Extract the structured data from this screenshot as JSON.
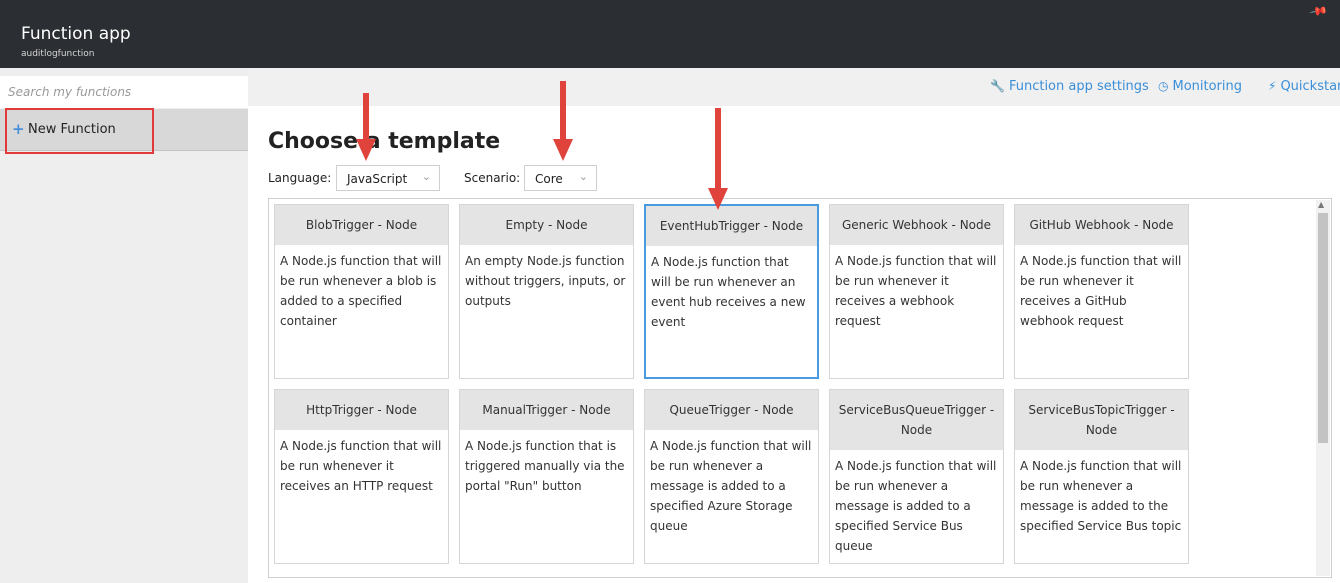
{
  "header": {
    "title": "Function app",
    "subtitle": "auditlogfunction"
  },
  "sidebar": {
    "search_placeholder": "Search my functions",
    "new_function_label": "New Function"
  },
  "toolbar": {
    "links": [
      {
        "label": "Function app settings",
        "icon": "wrench-icon"
      },
      {
        "label": "Monitoring",
        "icon": "clock-icon"
      },
      {
        "label": "Quickstart",
        "icon": "lightning-icon"
      }
    ]
  },
  "main": {
    "heading": "Choose a template",
    "language_label": "Language:",
    "language_value": "JavaScript",
    "scenario_label": "Scenario:",
    "scenario_value": "Core"
  },
  "templates": [
    {
      "title": "BlobTrigger - Node",
      "description": "A Node.js function that will be run whenever a blob is added to a specified container"
    },
    {
      "title": "Empty - Node",
      "description": "An empty Node.js function without triggers, inputs, or outputs"
    },
    {
      "title": "EventHubTrigger - Node",
      "description": "A Node.js function that will be run whenever an event hub receives a new event",
      "selected": true
    },
    {
      "title": "Generic Webhook - Node",
      "description": "A Node.js function that will be run whenever it receives a webhook request"
    },
    {
      "title": "GitHub Webhook - Node",
      "description": "A Node.js function that will be run whenever it receives a GitHub webhook request"
    },
    {
      "title": "HttpTrigger - Node",
      "description": "A Node.js function that will be run whenever it receives an HTTP request"
    },
    {
      "title": "ManualTrigger - Node",
      "description": "A Node.js function that is triggered manually via the portal \"Run\" button"
    },
    {
      "title": "QueueTrigger - Node",
      "description": "A Node.js function that will be run whenever a message is added to a specified Azure Storage queue"
    },
    {
      "title": "ServiceBusQueueTrigger - Node",
      "description": "A Node.js function that will be run whenever a message is added to a specified Service Bus queue"
    },
    {
      "title": "ServiceBusTopicTrigger - Node",
      "description": "A Node.js function that will be run whenever a message is added to the specified Service Bus topic"
    }
  ],
  "colors": {
    "accent": "#3a8fd8",
    "annotation_red": "#e0433c",
    "header_bg": "#2b2e33"
  }
}
